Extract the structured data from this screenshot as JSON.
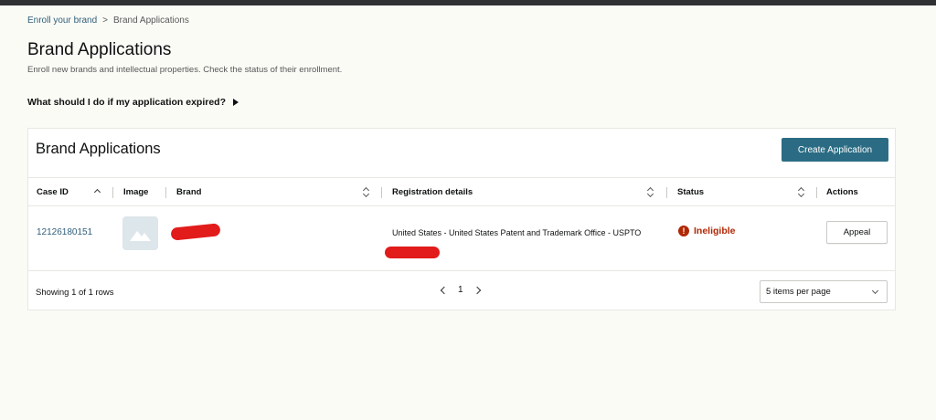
{
  "breadcrumb": {
    "items": [
      "Enroll your brand",
      "Brand Applications"
    ],
    "separator": ">"
  },
  "page": {
    "title": "Brand Applications",
    "subtitle": "Enroll new brands and intellectual properties. Check the status of their enrollment."
  },
  "faq": {
    "label": "What should I do if my application expired?"
  },
  "card": {
    "title": "Brand Applications",
    "create_button": "Create Application"
  },
  "table": {
    "columns": [
      "Case ID",
      "Image",
      "Brand",
      "Registration details",
      "Status",
      "Actions"
    ],
    "rows": [
      {
        "case_id": "12126180151",
        "registration": "United States - United States Patent and Trademark Office - USPTO",
        "status": "Ineligible",
        "action": "Appeal"
      }
    ]
  },
  "footer": {
    "showing": "Showing 1 of 1 rows",
    "current_page": "1",
    "per_page": "5 items per page"
  },
  "colors": {
    "accent": "#2b6c84",
    "link": "#2f5f7a",
    "error": "#b12704",
    "redaction": "#e21b1b"
  }
}
